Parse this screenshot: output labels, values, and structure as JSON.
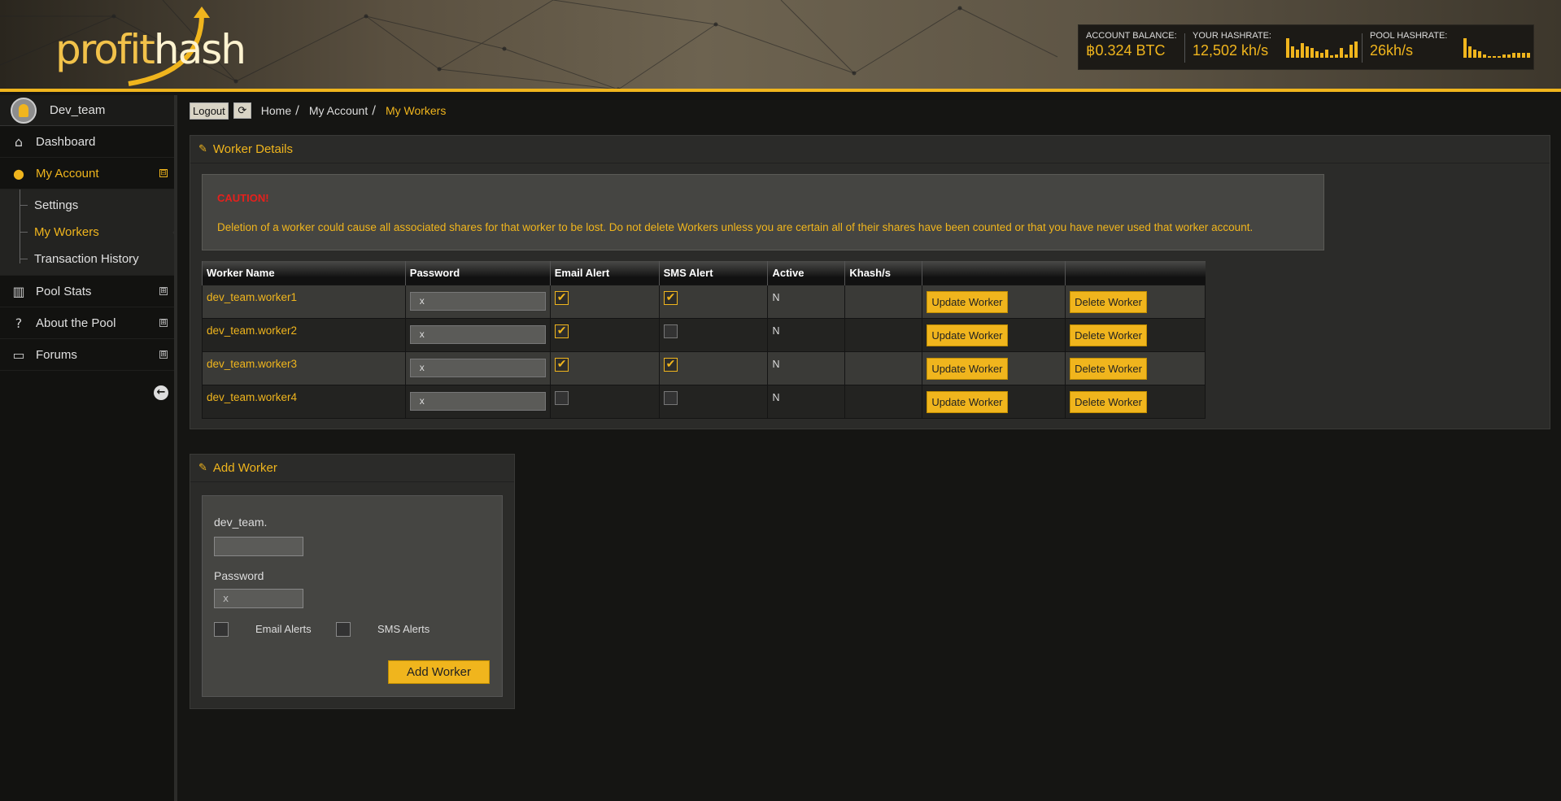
{
  "header": {
    "logo_left": "profit",
    "logo_right": "hash",
    "account_balance_label": "ACCOUNT BALANCE:",
    "account_balance_value": "฿0.324 BTC",
    "your_hashrate_label": "YOUR HASHRATE:",
    "your_hashrate_value": "12,502 kh/s",
    "pool_hashrate_label": "POOL HASHRATE:",
    "pool_hashrate_value": "26kh/s",
    "accent_color": "#f0b51d"
  },
  "sidebar": {
    "user_name": "Dev_team",
    "items": [
      {
        "label": "Dashboard",
        "icon": "home-icon"
      },
      {
        "label": "My Account",
        "icon": "user-icon",
        "toggle": "⊟"
      },
      {
        "label": "Pool Stats",
        "icon": "bar-chart-icon",
        "toggle": "⊞"
      },
      {
        "label": "About the Pool",
        "icon": "question-icon",
        "toggle": "⊞"
      },
      {
        "label": "Forums",
        "icon": "folder-open-icon",
        "toggle": "⊞"
      }
    ],
    "subitems": [
      {
        "label": "Settings"
      },
      {
        "label": "My Workers"
      },
      {
        "label": "Transaction History"
      }
    ]
  },
  "toolbar": {
    "logout_label": "Logout",
    "breadcrumb": [
      "Home",
      "My Account",
      "My Workers"
    ]
  },
  "worker_details": {
    "title": "Worker Details",
    "caution_title": "CAUTION!",
    "caution_message": "Deletion of a worker could cause all associated shares for that worker to be lost. Do not delete Workers unless you are certain all of their shares have been counted or that you have never used that worker account.",
    "columns": [
      "Worker Name",
      "Password",
      "Email Alert",
      "SMS Alert",
      "Active",
      "Khash/s",
      "",
      ""
    ],
    "update_label": "Update Worker",
    "delete_label": "Delete Worker",
    "rows": [
      {
        "name": "dev_team.worker1",
        "password": "x",
        "email": true,
        "sms": true,
        "active": "N",
        "khash": ""
      },
      {
        "name": "dev_team.worker2",
        "password": "x",
        "email": true,
        "sms": false,
        "active": "N",
        "khash": ""
      },
      {
        "name": "dev_team.worker3",
        "password": "x",
        "email": true,
        "sms": true,
        "active": "N",
        "khash": ""
      },
      {
        "name": "dev_team.worker4",
        "password": "x",
        "email": false,
        "sms": false,
        "active": "N",
        "khash": ""
      }
    ]
  },
  "add_worker": {
    "title": "Add Worker",
    "prefix_label": "dev_team.",
    "worker_name_value": "",
    "password_label": "Password",
    "password_value": "x",
    "email_alerts_label": "Email Alerts",
    "sms_alerts_label": "SMS Alerts",
    "submit_label": "Add Worker"
  }
}
